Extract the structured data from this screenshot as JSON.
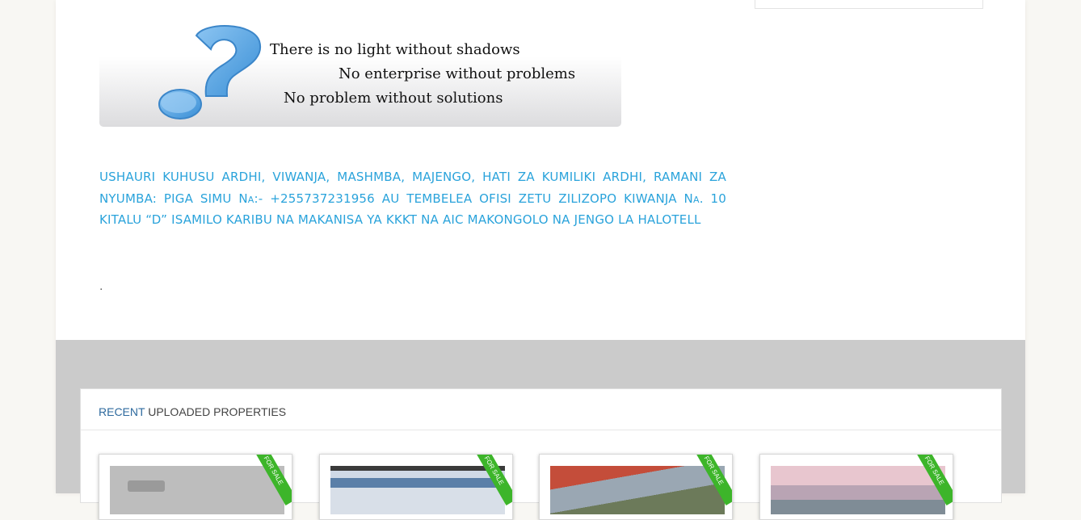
{
  "banner": {
    "line1": "There is no light without shadows",
    "line2": "No enterprise without problems",
    "line3": "No problem without solutions"
  },
  "info": {
    "text": "USHAURI KUHUSU ARDHI, VIWANJA, MASHMBA, MAJENGO, HATI ZA KUMILIKI ARDHI, RAMANI ZA NYUMBA: PIGA SIMU Na:- +255737231956 AU TEMBELEA OFISI ZETU ZILIZOPO KIWANJA Na. 10 KITALU “D” ISAMILO KARIBU NA MAKANISA YA KKKT NA AIC MAKONGOLO NA JENGO LA HALOTELL",
    "dot": "."
  },
  "recent": {
    "title_accent": "RECENT",
    "title_rest": " UPLOADED PROPERTIES",
    "cards": [
      {
        "ribbon": "FOR SALE"
      },
      {
        "ribbon": "FOR SALE"
      },
      {
        "ribbon": "FOR SALE"
      },
      {
        "ribbon": "FOR SALE"
      }
    ]
  },
  "colors": {
    "accent_text": "#2aa3db",
    "recent_accent": "#2e6a9e",
    "ribbon": "#3db52a",
    "band": "#cbcbcb"
  }
}
